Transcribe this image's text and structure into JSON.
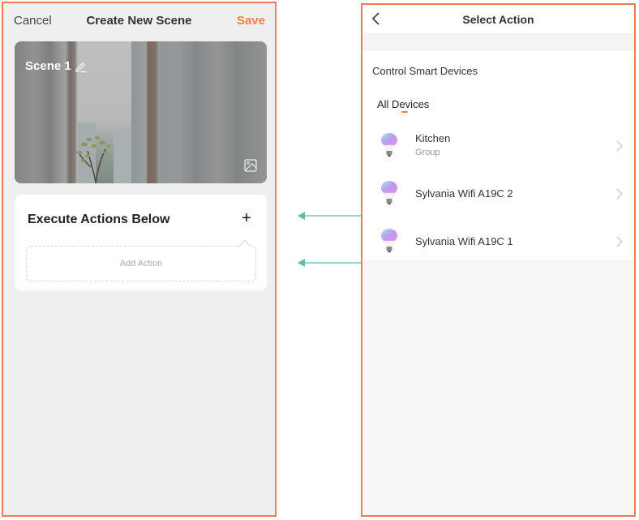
{
  "left_screen": {
    "header": {
      "cancel_label": "Cancel",
      "title": "Create New Scene",
      "save_label": "Save"
    },
    "scene": {
      "name": "Scene 1",
      "edit_icon": "pencil-icon",
      "image_icon": "image-icon"
    },
    "actions_card": {
      "heading": "Execute Actions Below",
      "add_icon": "plus-icon",
      "add_action_label": "Add Action"
    }
  },
  "right_screen": {
    "header": {
      "back_icon": "chevron-left-icon",
      "title": "Select Action"
    },
    "section_title": "Control Smart Devices",
    "active_tab": "All Devices",
    "devices": [
      {
        "name": "Kitchen",
        "subtitle": "Group",
        "icon": "rgb-bulb-icon"
      },
      {
        "name": "Sylvania Wifi A19C 2",
        "subtitle": "",
        "icon": "rgb-bulb-icon"
      },
      {
        "name": "Sylvania Wifi A19C 1",
        "subtitle": "",
        "icon": "rgb-bulb-icon"
      }
    ]
  },
  "colors": {
    "accent": "#ef8048",
    "frame_border": "#ef7a55",
    "connector": "#5db9b2"
  }
}
